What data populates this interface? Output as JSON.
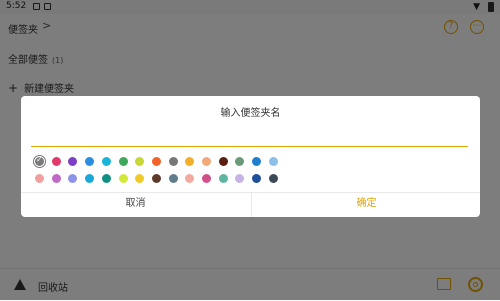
{
  "statusbar": {
    "time": "5:52"
  },
  "header": {
    "title": "便签夹",
    "chevron": ">",
    "help": "?",
    "more": "⋯"
  },
  "folders": {
    "all_label": "全部便签",
    "all_count": "(1)"
  },
  "new_folder_label": "新建便签夹",
  "bottombar": {
    "trash_label": "回收站"
  },
  "dialog": {
    "title": "输入便签夹名",
    "input_value": "",
    "input_placeholder": "",
    "cancel_label": "取消",
    "ok_label": "确定",
    "selected_index": 0,
    "colors_row1": [
      "#7b7b7b",
      "#e03a6a",
      "#7a3fc4",
      "#2a8fe0",
      "#17b5d6",
      "#3fa85a",
      "#c8d63a",
      "#f2622a",
      "#777777",
      "#f2b02a",
      "#f4a97a",
      "#5a1e12",
      "#6b9a78",
      "#1f7fcf",
      "#8cc0e8"
    ],
    "colors_row2": [
      "#f0a0a0",
      "#c06ac8",
      "#8c94e8",
      "#19a6d8",
      "#108f84",
      "#d4e83a",
      "#f0c92a",
      "#5e3a2a",
      "#607d8b",
      "#f2a9a0",
      "#d0508a",
      "#5fb6a0",
      "#c9b3e6",
      "#1d4f9a",
      "#3c4a58"
    ]
  }
}
